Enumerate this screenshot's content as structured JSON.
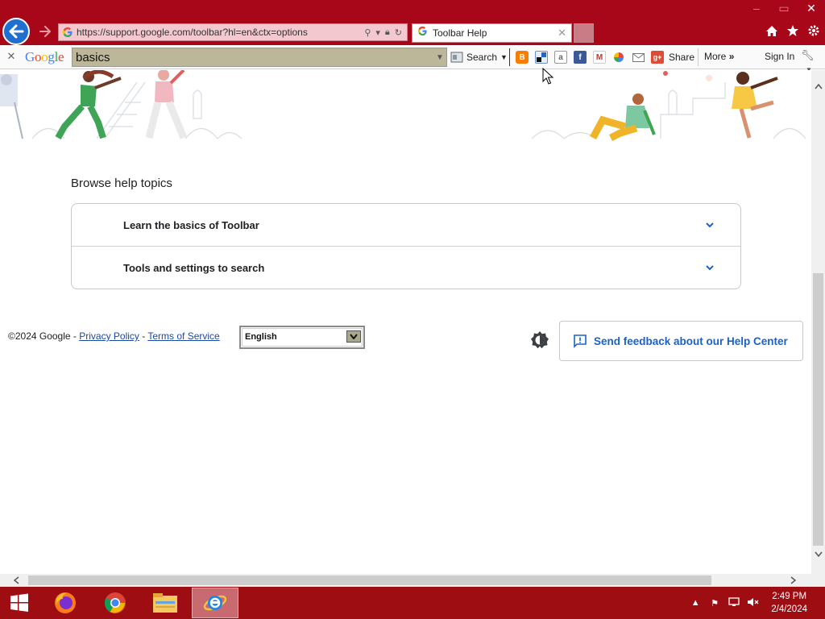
{
  "browser": {
    "url": "https://support.google.com/toolbar?hl=en&ctx=options",
    "tab_title": "Toolbar Help",
    "window_controls": [
      "minimize",
      "maximize",
      "close"
    ],
    "accent": "#a8071a"
  },
  "google_toolbar": {
    "logo": "Google",
    "search_value": "basics",
    "search_button": "Search",
    "share_label": "Share",
    "more_label": "More",
    "signin_label": "Sign In",
    "buttons": [
      "blogger-icon",
      "highlight-icon",
      "translate-icon",
      "facebook-icon",
      "gmail-icon",
      "photos-icon",
      "mail-icon",
      "google-plus-icon"
    ]
  },
  "page": {
    "browse_title": "Browse help topics",
    "topics": [
      {
        "label": "Learn the basics of Toolbar"
      },
      {
        "label": "Tools and settings to search"
      }
    ],
    "footer": {
      "copyright": "©2024 Google - ",
      "privacy": "Privacy Policy",
      "separator": " - ",
      "terms": "Terms of Service"
    },
    "language": "English",
    "feedback_label": "Send feedback about our Help Center"
  },
  "taskbar": {
    "apps": [
      "firefox-icon",
      "chrome-icon",
      "file-explorer-icon",
      "internet-explorer-icon"
    ],
    "time": "2:49 PM",
    "date": "2/4/2024"
  }
}
